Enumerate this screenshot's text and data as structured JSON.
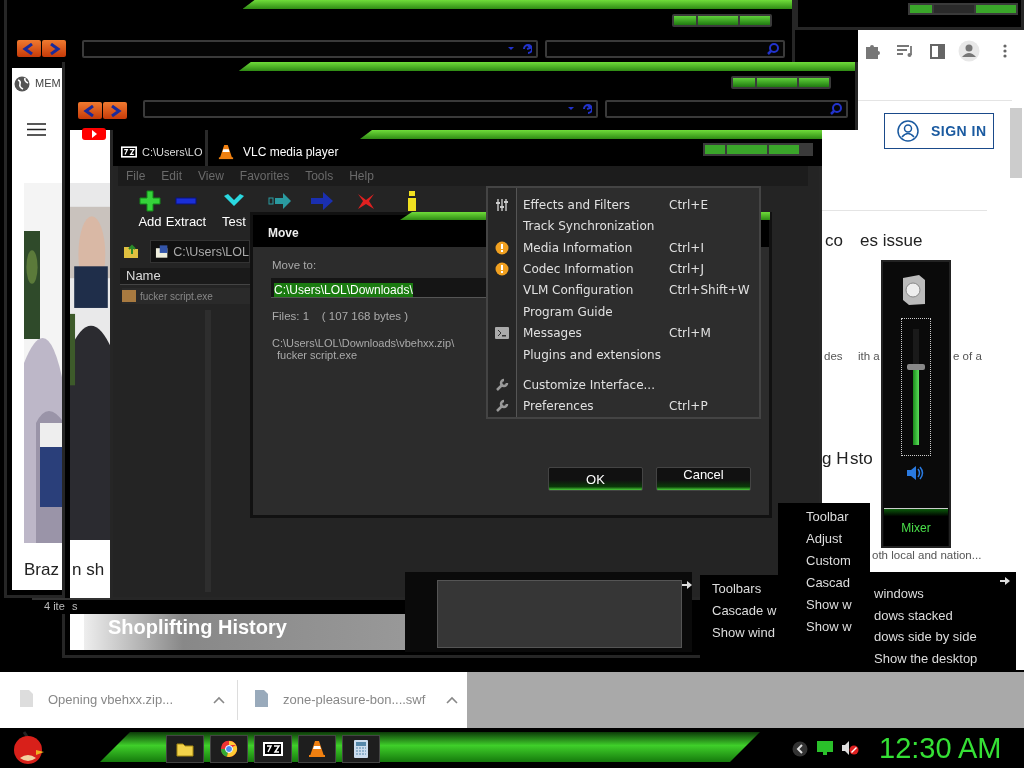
{
  "browser_back": {
    "tab_label": "MEM",
    "headline": "Braz"
  },
  "browser_front": {
    "headline": "n sh",
    "video_caption": "Shoplifting History"
  },
  "browser_right": {
    "sign_in": "SIGN IN",
    "fragments": [
      "co",
      "es issue",
      "des",
      "ith a",
      "e of a",
      "g H",
      "sto",
      "oth local and nation..."
    ]
  },
  "archive_window": {
    "title": "C:\\Users\\LO",
    "menu": [
      "File",
      "Edit",
      "View",
      "Favorites",
      "Tools",
      "Help"
    ],
    "toolbar": [
      {
        "kind": "add",
        "label": "Add"
      },
      {
        "kind": "extract",
        "label": "Extract"
      },
      {
        "kind": "test",
        "label": "Test"
      },
      {
        "kind": "copy"
      },
      {
        "kind": "move"
      },
      {
        "kind": "delete"
      },
      {
        "kind": "info"
      }
    ],
    "path": "C:\\Users\\LOL",
    "column": "Name",
    "files": [
      "fucker script.exe"
    ],
    "status": [
      "4 ite",
      "s"
    ]
  },
  "vlc_window": {
    "title": "VLC media player",
    "menu": [
      {
        "kind": "sliders",
        "label": "Effects and Filters",
        "shortcut": "Ctrl+E"
      },
      {
        "kind": "plain",
        "label": "Track Synchronization"
      },
      {
        "kind": "info",
        "label": "Media Information",
        "shortcut": "Ctrl+I"
      },
      {
        "kind": "info",
        "label": "Codec Information",
        "shortcut": "Ctrl+J"
      },
      {
        "kind": "plain",
        "label": "VLM Configuration",
        "shortcut": "Ctrl+Shift+W"
      },
      {
        "kind": "plain",
        "label": "Program Guide"
      },
      {
        "kind": "terminal",
        "label": "Messages",
        "shortcut": "Ctrl+M"
      },
      {
        "kind": "plain",
        "label": "Plugins and extensions"
      },
      {
        "kind": "separator"
      },
      {
        "kind": "wrench",
        "label": "Customize Interface..."
      },
      {
        "kind": "wrench",
        "label": "Preferences",
        "shortcut": "Ctrl+P"
      }
    ]
  },
  "move_dialog": {
    "title": "Move",
    "field_label": "Move to:",
    "value": "C:\\Users\\LOL\\Downloads\\",
    "files_info": "Files: 1    ( 107 168 bytes )",
    "source": [
      "C:\\Users\\LOL\\Downloads\\vbehxx.zip\\",
      "fucker script.exe"
    ],
    "buttons": [
      "OK",
      "Cancel"
    ]
  },
  "mixer": {
    "level": 0.67,
    "label": "Mixer"
  },
  "context_menus": [
    {
      "items": [
        "Toolbars",
        "Cascade w",
        "Show wind"
      ]
    },
    {
      "items": [
        "windows",
        "dows stacked",
        "dows side by side",
        "Show the desktop"
      ]
    },
    {
      "items": [
        "Toolbar",
        "Adjust",
        "Custom",
        "Cascad",
        "Show w",
        "Show w"
      ]
    }
  ],
  "downloads": [
    {
      "kind": "zip",
      "name": "Opening vbehxx.zip..."
    },
    {
      "kind": "file",
      "name": "zone-pleasure-bon....swf"
    }
  ],
  "taskbar": {
    "apps": [
      {
        "kind": "folder"
      },
      {
        "kind": "browser"
      },
      {
        "kind": "archiver"
      },
      {
        "kind": "cone"
      },
      {
        "kind": "calculator"
      }
    ],
    "clock": "12:30 AM"
  }
}
